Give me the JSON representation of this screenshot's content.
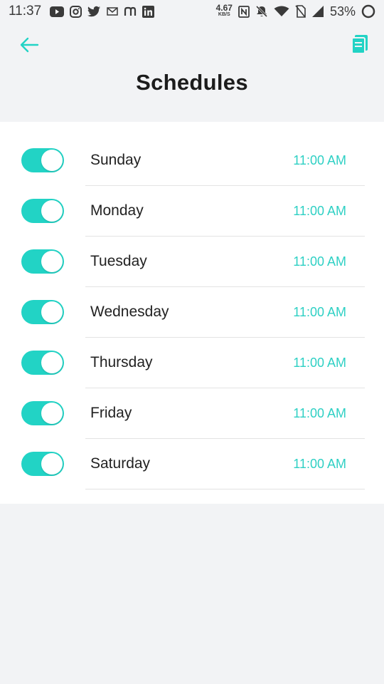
{
  "status_bar": {
    "time": "11:37",
    "net_speed_value": "4.67",
    "net_speed_unit": "KB/S",
    "battery": "53%",
    "icons": [
      "youtube-icon",
      "instagram-icon",
      "twitter-icon",
      "mail-icon",
      "n-icon",
      "linkedin-icon",
      "nfc-icon",
      "mute-icon",
      "wifi-icon",
      "no-sim-icon",
      "signal-icon",
      "battery-icon"
    ]
  },
  "header": {
    "title": "Schedules",
    "back_icon": "back-arrow-icon",
    "action_icon": "document-icon"
  },
  "colors": {
    "accent": "#22d3c5",
    "background": "#f2f3f5",
    "card": "#ffffff"
  },
  "schedules": [
    {
      "day": "Sunday",
      "time": "11:00 AM",
      "enabled": true
    },
    {
      "day": "Monday",
      "time": "11:00 AM",
      "enabled": true
    },
    {
      "day": "Tuesday",
      "time": "11:00 AM",
      "enabled": true
    },
    {
      "day": "Wednesday",
      "time": "11:00 AM",
      "enabled": true
    },
    {
      "day": "Thursday",
      "time": "11:00 AM",
      "enabled": true
    },
    {
      "day": "Friday",
      "time": "11:00 AM",
      "enabled": true
    },
    {
      "day": "Saturday",
      "time": "11:00 AM",
      "enabled": true
    }
  ]
}
